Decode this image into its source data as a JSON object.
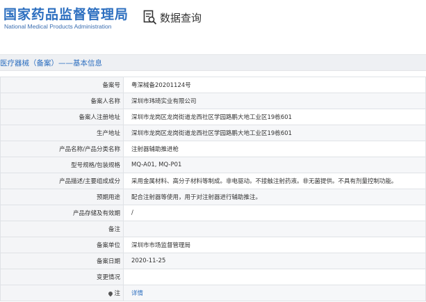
{
  "header": {
    "site_title": "国家药品监督管理局",
    "site_subtitle": "National Medical Products Administration",
    "query_label": "数据查询"
  },
  "breadcrumb": "医疗器械（备案）——基本信息",
  "rows": [
    {
      "label": "备案号",
      "value": "粤深械备20201124号"
    },
    {
      "label": "备案人名称",
      "value": "深圳市玮琦实业有限公司"
    },
    {
      "label": "备案人注册地址",
      "value": "深圳市龙岗区龙岗街道龙西社区学园路鹏大地工业区19栋601"
    },
    {
      "label": "生产地址",
      "value": "深圳市龙岗区龙岗街道龙西社区学园路鹏大地工业区19栋601"
    },
    {
      "label": "产品名称/产品分类名称",
      "value": "注射器辅助推进枪"
    },
    {
      "label": "型号规格/包装规格",
      "value": "MQ-A01, MQ-P01"
    },
    {
      "label": "产品描述/主要组成成分",
      "value": "采用金属材料、高分子材料等制成。非电驱动。不接触注射药液。非无菌提供。不具有剂量控制功能。"
    },
    {
      "label": "预期用途",
      "value": "配合注射器等使用，用于对注射器进行辅助推注。"
    },
    {
      "label": "产品存储及有效期",
      "value": "/"
    },
    {
      "label": "备注",
      "value": ""
    },
    {
      "label": "备案单位",
      "value": "深圳市市场监督管理局"
    },
    {
      "label": "备案日期",
      "value": "2020-11-25"
    },
    {
      "label": "变更情况",
      "value": ""
    }
  ],
  "footer_row": {
    "label": "注",
    "value": "详情"
  }
}
